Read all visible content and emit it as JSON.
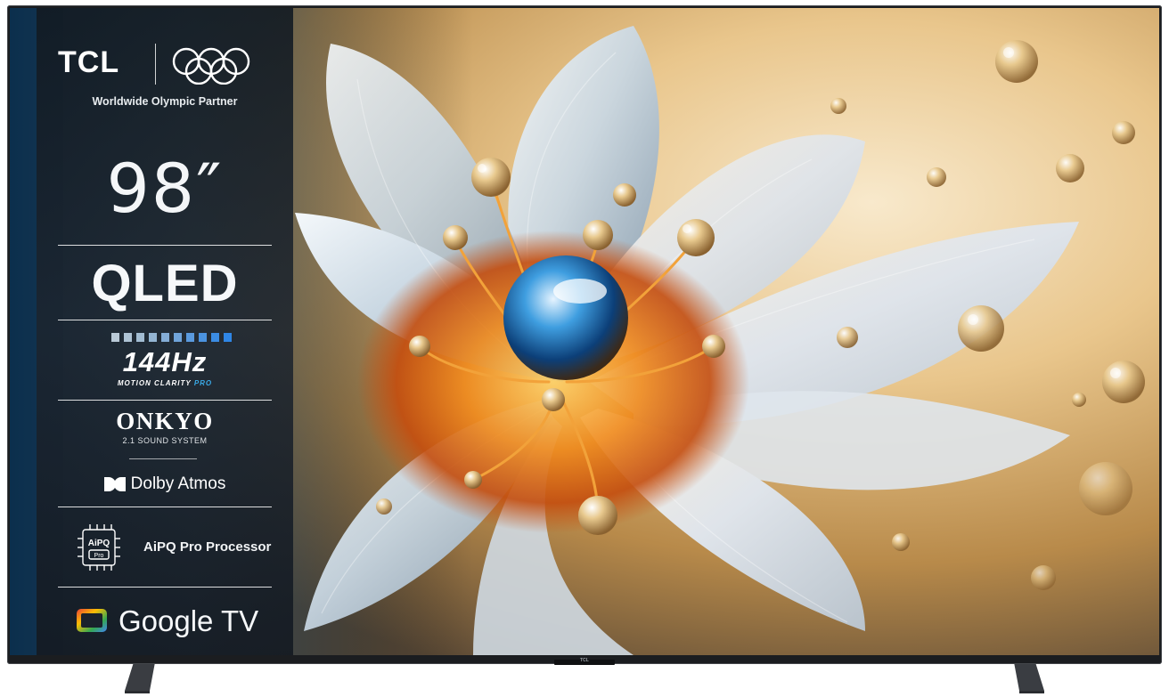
{
  "brand": {
    "name": "TCL",
    "partner": "Worldwide Olympic Partner"
  },
  "specs": {
    "size": "98″",
    "panel": "QLED",
    "refresh": {
      "value": "144Hz",
      "caption": "MOTION CLARITY",
      "caption_pro": "PRO"
    },
    "audio": {
      "brand": "ONKYO",
      "system": "2.1 SOUND SYSTEM",
      "dolby": "Dolby Atmos"
    },
    "processor": {
      "chip_label": "AiPQ",
      "chip_sub": "Pro",
      "label": "AiPQ Pro Processor"
    },
    "os": "Google TV"
  },
  "chin": "TCL",
  "icons": [
    "olympic-rings-icon",
    "refresh-bars-icon",
    "dolby-icon",
    "aipq-chip-icon",
    "google-tv-icon"
  ],
  "colors": {
    "panel": "#1a222c",
    "accent_blue": "#3aa9e6",
    "gold": "#f0a020"
  }
}
